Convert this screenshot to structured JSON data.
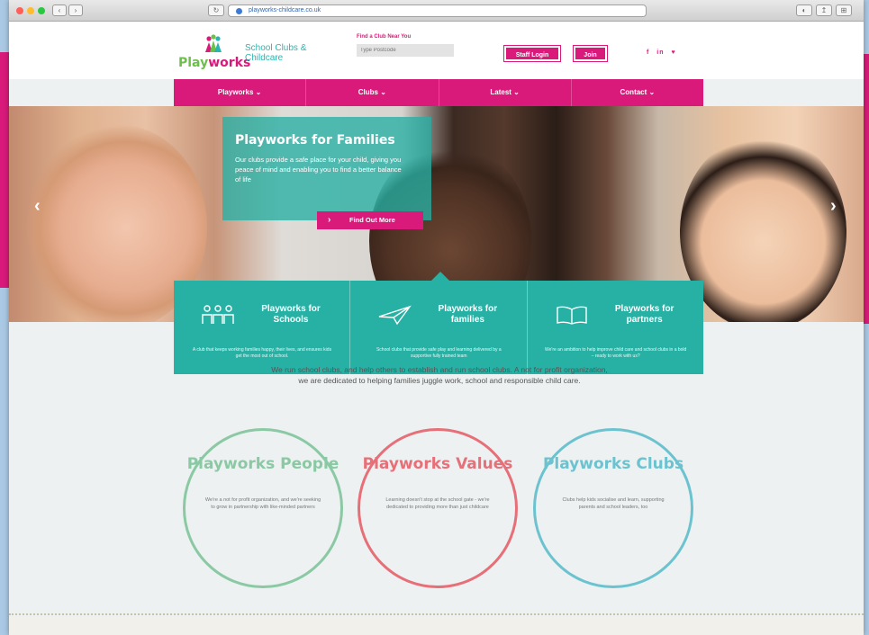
{
  "browser": {
    "url": "playworks-childcare.co.uk",
    "nav_back": "‹",
    "nav_forward": "›",
    "reload": "↻",
    "toolbar_icons": [
      "◐",
      "↥",
      "⊞"
    ]
  },
  "header": {
    "logo_prefix": "Play",
    "logo_suffix": "works",
    "tagline": "School Clubs & Childcare",
    "find_label": "Find a Club Near You",
    "find_placeholder": "Type Postcode",
    "staff_login": "Staff Login",
    "join": "Join",
    "social": [
      "f",
      "in",
      "♥"
    ]
  },
  "nav": [
    {
      "label": "Playworks"
    },
    {
      "label": "Clubs"
    },
    {
      "label": "Latest"
    },
    {
      "label": "Contact"
    }
  ],
  "hero": {
    "title": "Playworks for Families",
    "text": "Our clubs provide a safe place for your child, giving you peace of mind and enabling you to find a better balance of life",
    "cta": "Find Out More"
  },
  "panels": [
    {
      "title": "Playworks for Schools",
      "text": "A club that keeps working families happy, their lives, and ensures kids get the most out of school.",
      "icon": "school-children-icon"
    },
    {
      "title": "Playworks for families",
      "text": "School clubs that provide safe play and learning delivered by a supportive fully trained team",
      "icon": "paper-plane-icon"
    },
    {
      "title": "Playworks for partners",
      "text": "We're an ambition to help improve child care and school clubs in a bold – ready to work with us?",
      "icon": "open-book-icon"
    }
  ],
  "intro": "We run school clubs, and help others to establish and run school clubs. A not for profit organization, we are dedicated to helping families juggle work, school and responsible child care.",
  "circles": [
    {
      "title": "Playworks People",
      "text": "We're a not for profit organization, and we're seeking to grow in partnership with like-minded partners"
    },
    {
      "title": "Playworks Values",
      "text": "Learning doesn't stop at the school gate - we're dedicated to providing more than just childcare"
    },
    {
      "title": "Playworks Clubs",
      "text": "Clubs help kids socialise and learn, supporting parents and school leaders, too"
    }
  ],
  "colors": {
    "brand_pink": "#d91a7a",
    "teal": "#27b0a4",
    "green": "#8ac9a3",
    "coral": "#e66f78",
    "aqua": "#6cc3cf"
  }
}
